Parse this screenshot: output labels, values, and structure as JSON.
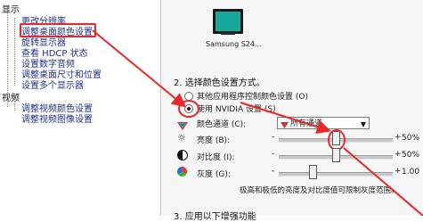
{
  "tree": {
    "display_root": "显示",
    "display_items": [
      "更改分辨率",
      "调整桌面颜色设置",
      "旋转显示器",
      "查看 HDCP 状态",
      "设置数字音频",
      "调整桌面尺寸和位置",
      "设置多个显示器"
    ],
    "video_root": "视频",
    "video_items": [
      "调整视频颜色设置",
      "调整视频图像设置"
    ]
  },
  "monitor": {
    "label": "Samsung S24..."
  },
  "section2": {
    "heading": "2. 选择颜色设置方式。",
    "radio_other": "其他应用程序控制颜色设置 (O)",
    "radio_nvidia": "使用 NVIDIA 设置 (S)",
    "channel_label": "颜色通道 (C):",
    "channel_value": "所有通道",
    "brightness_label": "亮度 (B):",
    "brightness_value": "50%",
    "brightness_level": 0.5,
    "contrast_label": "对比度 (I):",
    "contrast_value": "50%",
    "contrast_level": 0.5,
    "gamma_label": "灰度 (G):",
    "gamma_value": "1.00",
    "gamma_level": 0.3,
    "minus": "-",
    "plus": "+",
    "note": "极高和极低的亮度及对比度值可限制灰度范围。"
  },
  "section3": {
    "heading": "3. 应用以下增强功能"
  },
  "colors": {
    "annotation_red": "#e8282a",
    "link_blue": "#20308a",
    "monitor_teal": "#18a79b"
  }
}
